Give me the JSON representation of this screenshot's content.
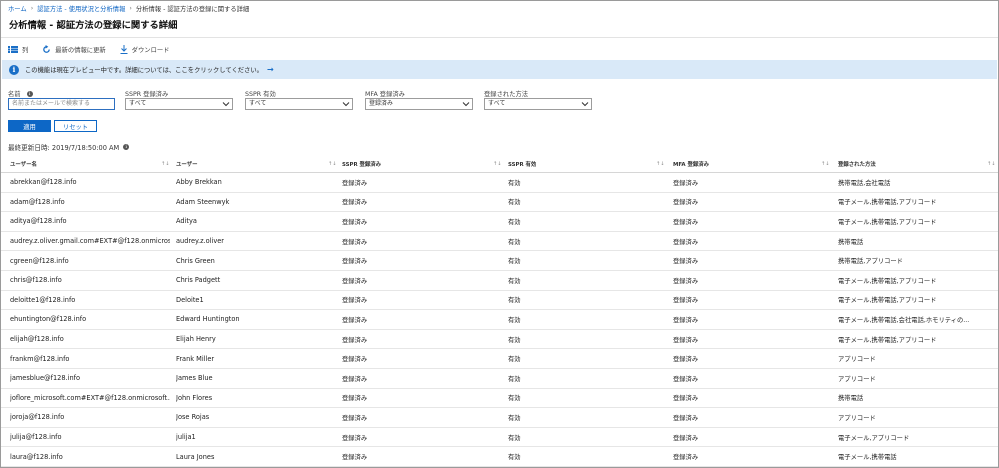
{
  "breadcrumb": {
    "home": "ホーム",
    "auth_methods": "認証方法 - 使用状況と分析情報",
    "current": "分析情報 - 認証方法の登録に関する詳細"
  },
  "page_title": "分析情報 - 認証方法の登録に関する詳細",
  "toolbar": {
    "columns": "列",
    "refresh": "最新の情報に更新",
    "download": "ダウンロード"
  },
  "banner": {
    "text": "この機能は現在プレビュー中です。詳細については、ここをクリックしてください。",
    "arrow": "→"
  },
  "filters": {
    "name": {
      "label": "名前",
      "placeholder": "名前またはメールで検索する"
    },
    "sspr_registered": {
      "label": "SSPR 登録済み",
      "value": "すべて"
    },
    "sspr_enabled": {
      "label": "SSPR 有効",
      "value": "すべて"
    },
    "mfa_registered": {
      "label": "MFA 登録済み",
      "value": "登録済み"
    },
    "registered_method": {
      "label": "登録された方法",
      "value": "すべて"
    },
    "apply": "適用",
    "reset": "リセット"
  },
  "last_updated": "最終更新日時: 2019/7/18:50:00 AM",
  "table": {
    "headers": [
      "ユーザー名",
      "ユーザー",
      "SSPR 登録済み",
      "SSPR 有効",
      "MFA 登録済み",
      "登録された方法"
    ],
    "rows": [
      [
        "abrekkan@f128.info",
        "Abby Brekkan",
        "登録済み",
        "有効",
        "登録済み",
        "携帯電話,会社電話"
      ],
      [
        "adam@f128.info",
        "Adam Steenwyk",
        "登録済み",
        "有効",
        "登録済み",
        "電子メール,携帯電話,アプリコード"
      ],
      [
        "aditya@f128.info",
        "Aditya",
        "登録済み",
        "有効",
        "登録済み",
        "電子メール,携帯電話,アプリコード"
      ],
      [
        "audrey.z.oliver.gmail.com#EXT#@f128.onmicros...",
        "audrey.z.oliver",
        "登録済み",
        "有効",
        "登録済み",
        "携帯電話"
      ],
      [
        "cgreen@f128.info",
        "Chris Green",
        "登録済み",
        "有効",
        "登録済み",
        "携帯電話,アプリコード"
      ],
      [
        "chris@f128.info",
        "Chris Padgett",
        "登録済み",
        "有効",
        "登録済み",
        "電子メール,携帯電話,アプリコード"
      ],
      [
        "deloitte1@f128.info",
        "Deloite1",
        "登録済み",
        "有効",
        "登録済み",
        "電子メール,携帯電話,アプリコード"
      ],
      [
        "ehuntington@f128.info",
        "Edward Huntington",
        "登録済み",
        "有効",
        "登録済み",
        "電子メール,携帯電話,会社電話,ホモリティの..."
      ],
      [
        "elijah@f128.info",
        "Elijah Henry",
        "登録済み",
        "有効",
        "登録済み",
        "電子メール,携帯電話,アプリコード"
      ],
      [
        "frankm@f128.info",
        "Frank Miller",
        "登録済み",
        "有効",
        "登録済み",
        "アプリコード"
      ],
      [
        "jamesblue@f128.info",
        "James Blue",
        "登録済み",
        "有効",
        "登録済み",
        "アプリコード"
      ],
      [
        "joflore_microsoft.com#EXT#@f128.onmicrosoft...",
        "John Flores",
        "登録済み",
        "有効",
        "登録済み",
        "携帯電話"
      ],
      [
        "joroja@f128.info",
        "Jose Rojas",
        "登録済み",
        "有効",
        "登録済み",
        "アプリコード"
      ],
      [
        "julija@f128.info",
        "julija1",
        "登録済み",
        "有効",
        "登録済み",
        "電子メール,アプリコード"
      ],
      [
        "laura@f128.info",
        "Laura Jones",
        "登録済み",
        "有効",
        "登録済み",
        "電子メール,携帯電話"
      ]
    ]
  },
  "colors": {
    "accent": "#0d67c6",
    "banner_bg": "#d9e9f8",
    "link": "#0a62c2"
  },
  "icons": {
    "columns": "columns-icon",
    "refresh": "refresh-icon",
    "download": "download-icon",
    "info": "info-icon",
    "sort": "sort-icon",
    "chevron": "chevron-down-icon"
  }
}
